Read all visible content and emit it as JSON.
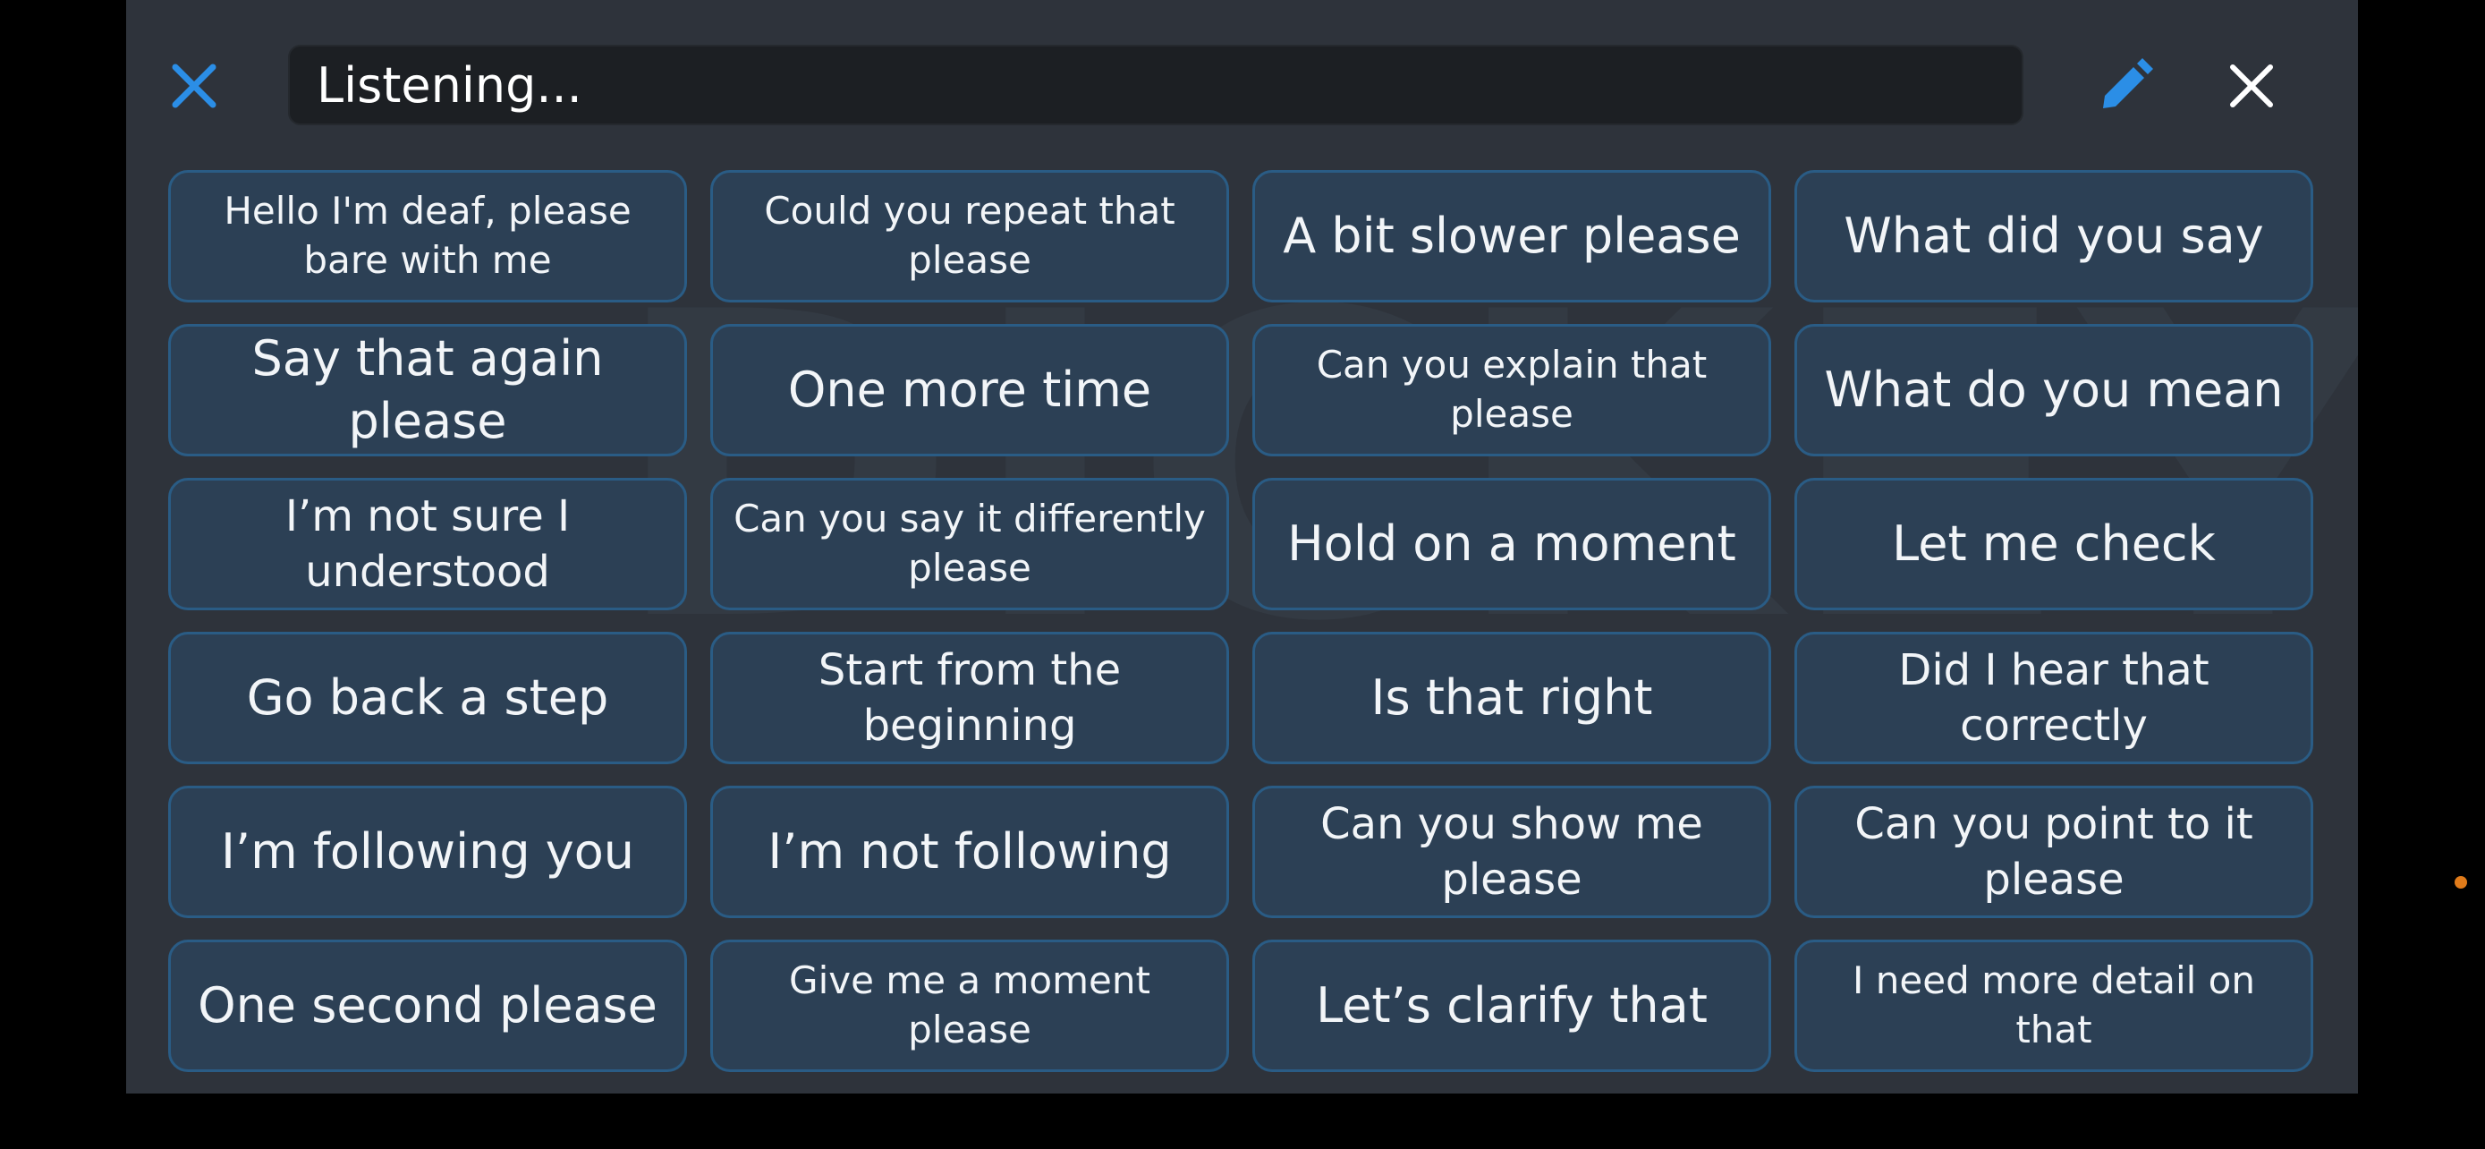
{
  "search": {
    "value": "Listening..."
  },
  "colors": {
    "accent": "#2b8ee6",
    "panel_bg": "#2e333b",
    "button_bg": "#2c4055",
    "button_border": "#2a5c85",
    "text": "#f2f5f8",
    "recording_dot": "#e07b1a"
  },
  "icons": {
    "left": "close-icon",
    "edit": "pencil-icon",
    "right": "close-icon"
  },
  "phrases": [
    "Hello I'm deaf, please bare with me",
    "Could you repeat that please",
    "A bit slower please",
    "What did you say",
    "Say that again please",
    "One more time",
    "Can you explain that please",
    "What do you mean",
    "I’m not sure I understood",
    "Can you say it differently please",
    "Hold on a moment",
    "Let me check",
    "Go back a step",
    "Start from the beginning",
    "Is that right",
    "Did I hear that correctly",
    "I’m following you",
    "I’m not following",
    "Can you show me please",
    "Can you point to it please",
    "One second please",
    "Give me a moment please",
    "Let’s clarify that",
    "I need more detail on that"
  ]
}
